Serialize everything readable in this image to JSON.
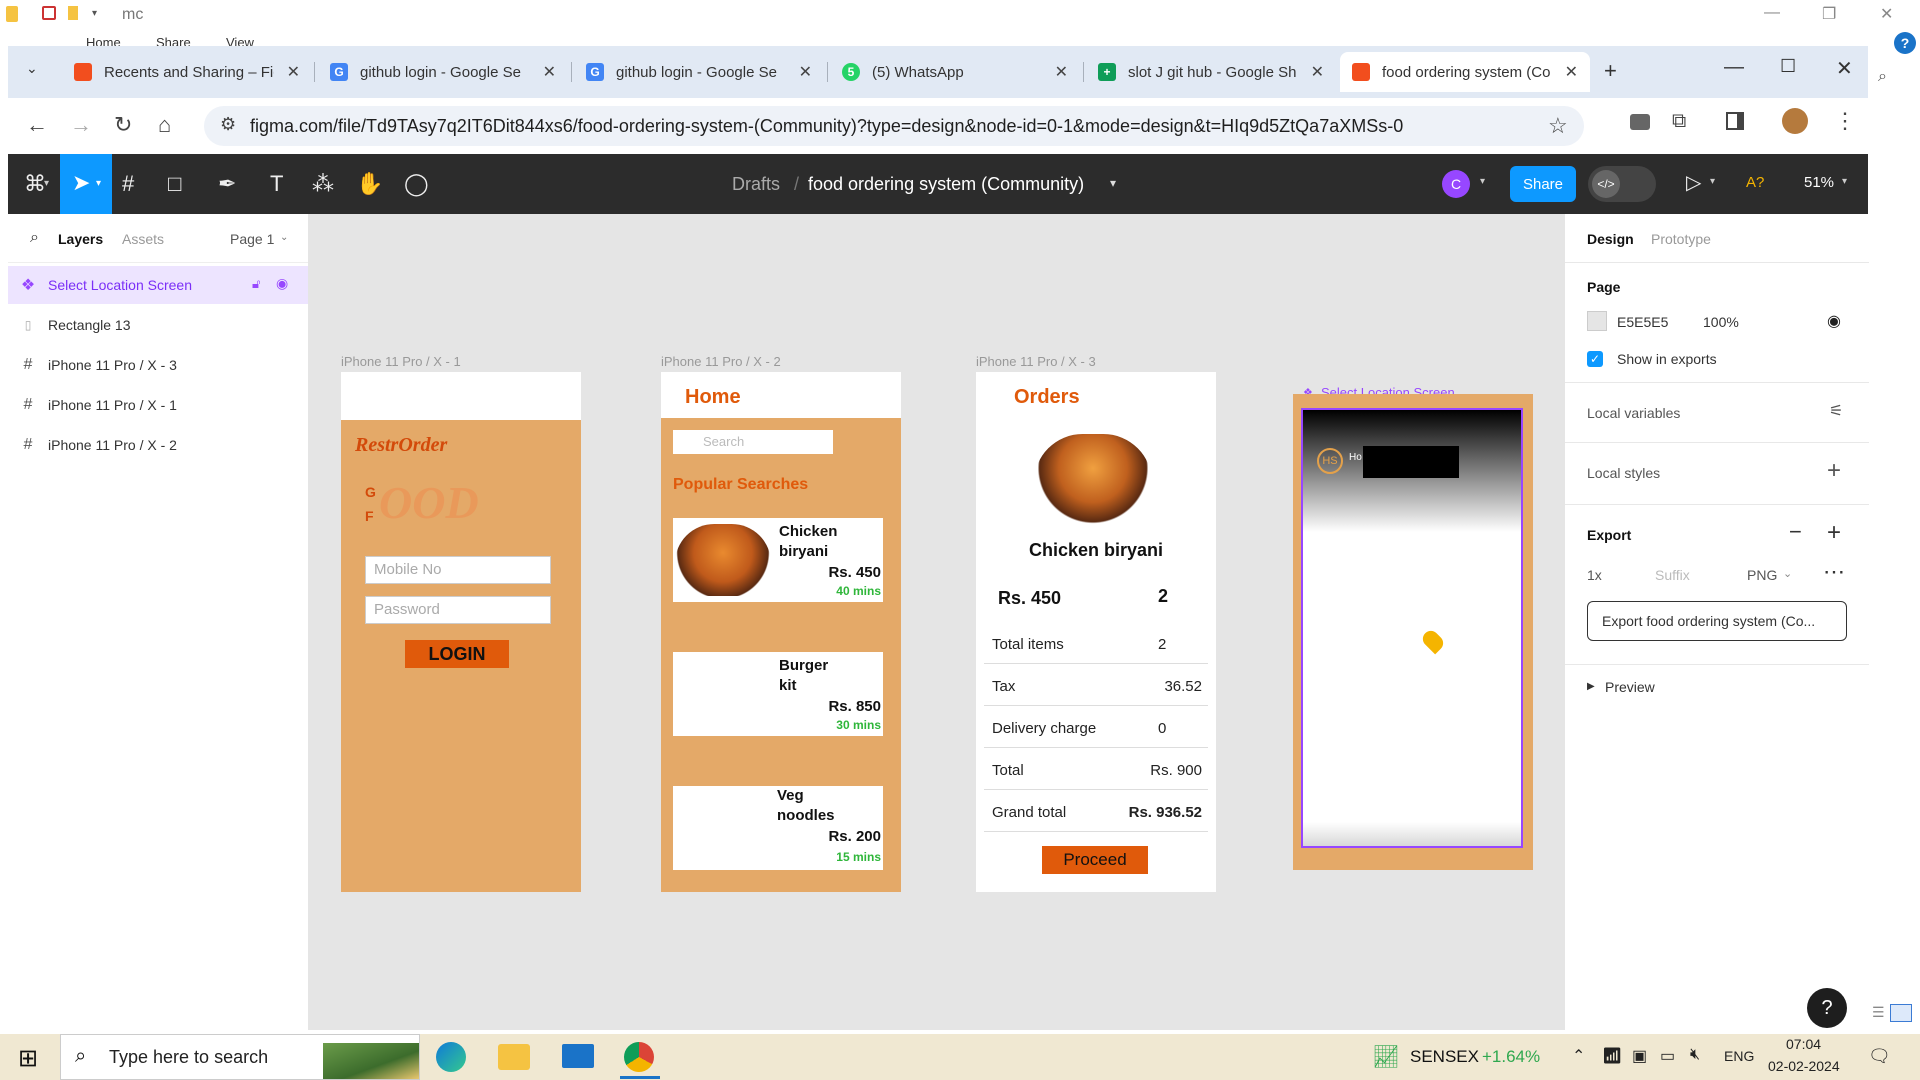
{
  "explorer": {
    "title": "mc",
    "menu": [
      "Home",
      "Share",
      "View"
    ]
  },
  "browser": {
    "tabs": [
      {
        "title": "Recents and Sharing – Fig",
        "icon": "figma-icon"
      },
      {
        "title": "github login - Google Se",
        "icon": "google-icon"
      },
      {
        "title": "github login - Google Se",
        "icon": "google-icon"
      },
      {
        "title": "(5) WhatsApp",
        "icon": "whatsapp-icon"
      },
      {
        "title": "slot J git hub - Google Sh",
        "icon": "sheets-icon"
      },
      {
        "title": "food ordering system (Co",
        "icon": "figma-icon"
      }
    ],
    "url": "figma.com/file/Td9TAsy7q2IT6Dit844xs6/food-ordering-system-(Community)?type=design&node-id=0-1&mode=design&t=HIq9d5ZtQa7aXMSs-0"
  },
  "figma": {
    "breadcrumb": "Drafts",
    "separator": "/",
    "file_name": "food ordering system (Community)",
    "avatar_initial": "C",
    "share_label": "Share",
    "a_label": "A?",
    "zoom": "51%"
  },
  "left_panel": {
    "tabs": [
      "Layers",
      "Assets"
    ],
    "page_selector": "Page 1",
    "layers": [
      {
        "name": "Select Location Screen",
        "selected": true,
        "icon": "component-icon"
      },
      {
        "name": "Rectangle 13",
        "icon": "rectangle-icon"
      },
      {
        "name": "iPhone 11 Pro / X - 3",
        "icon": "frame-icon"
      },
      {
        "name": "iPhone 11 Pro / X - 1",
        "icon": "frame-icon"
      },
      {
        "name": "iPhone 11 Pro / X - 2",
        "icon": "frame-icon"
      }
    ]
  },
  "canvas": {
    "frame1": {
      "label": "iPhone 11 Pro / X - 1",
      "brand": "RestrOrder",
      "logo_letters": "G F",
      "logo_word": "OOD",
      "mobile_placeholder": "Mobile No",
      "password_placeholder": "Password",
      "login_label": "LOGIN"
    },
    "frame2": {
      "label": "iPhone 11 Pro / X - 2",
      "title": "Home",
      "search_placeholder": "Search",
      "section_title": "Popular Searches",
      "items": [
        {
          "name": "Chicken biryani",
          "price": "Rs. 450",
          "time": "40 mins"
        },
        {
          "name": "Burger kit",
          "price": "Rs. 850",
          "time": "30 mins"
        },
        {
          "name": "Veg noodles",
          "price": "Rs. 200",
          "time": "15 mins"
        }
      ]
    },
    "frame3": {
      "label": "iPhone 11 Pro / X - 3",
      "title": "Orders",
      "dish": "Chicken biryani",
      "price": "Rs. 450",
      "qty": "2",
      "rows": [
        {
          "label": "Total items",
          "value": "2"
        },
        {
          "label": "Tax",
          "value": "36.52"
        },
        {
          "label": "Delivery charge",
          "value": "0"
        },
        {
          "label": "Total",
          "value": "Rs. 900"
        },
        {
          "label": "Grand total",
          "value": "Rs. 936.52"
        }
      ],
      "proceed_label": "Proceed"
    },
    "frame4": {
      "label": "Select Location Screen",
      "logo": "HS",
      "logo_suffix": "Ho"
    }
  },
  "right_panel": {
    "tabs": [
      "Design",
      "Prototype"
    ],
    "page_title": "Page",
    "page_color": "E5E5E5",
    "page_opacity": "100%",
    "show_in_exports": "Show in exports",
    "local_variables": "Local variables",
    "local_styles": "Local styles",
    "export_title": "Export",
    "export_scale": "1x",
    "export_suffix": "Suffix",
    "export_format": "PNG",
    "export_button": "Export food ordering system (Co...",
    "preview_label": "Preview",
    "help": "?"
  },
  "taskbar": {
    "search_placeholder": "Type here to search",
    "sensex_label": "SENSEX",
    "sensex_change": "+1.64%",
    "lang": "ENG",
    "time": "07:04",
    "date": "02-02-2024"
  },
  "colors": {
    "figma_dark": "#2c2c2c",
    "accent_blue": "#0d99ff",
    "frame_orange": "#e4a968",
    "brand_orange": "#e05a0b",
    "selection_purple": "#9747ff",
    "green": "#2fb63a"
  }
}
